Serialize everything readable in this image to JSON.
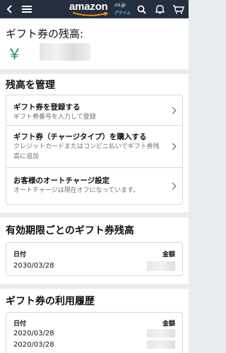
{
  "header": {
    "logo_text": "amazon",
    "logo_domain": ".co.jp",
    "logo_sub": "プライム",
    "icons": [
      "back-icon",
      "menu-icon",
      "search-icon",
      "bell-icon",
      "cart-icon"
    ],
    "bg_color": "#232f3e"
  },
  "balance": {
    "title": "ギフト券の残高:",
    "currency": "￥"
  },
  "manage": {
    "title": "残高を管理",
    "items": [
      {
        "label": "ギフト券を登録する",
        "sub": "ギフト券番号を入力して登録"
      },
      {
        "label": "ギフト券（チャージタイプ）を購入する",
        "sub": "クレジットカードまたはコンビニ払いでギフト券残高に追加"
      },
      {
        "label": "お客様のオートチャージ設定",
        "sub": "オートチャージは現在オフになっています。"
      }
    ]
  },
  "expiry": {
    "title": "有効期限ごとのギフト券残高",
    "date_header": "日付",
    "amount_header": "金額",
    "rows": [
      "2030/03/28"
    ]
  },
  "history": {
    "title": "ギフト券の利用履歴",
    "date_header": "日付",
    "amount_header": "金額",
    "rows": [
      "2020/03/28",
      "2020/03/28"
    ]
  }
}
